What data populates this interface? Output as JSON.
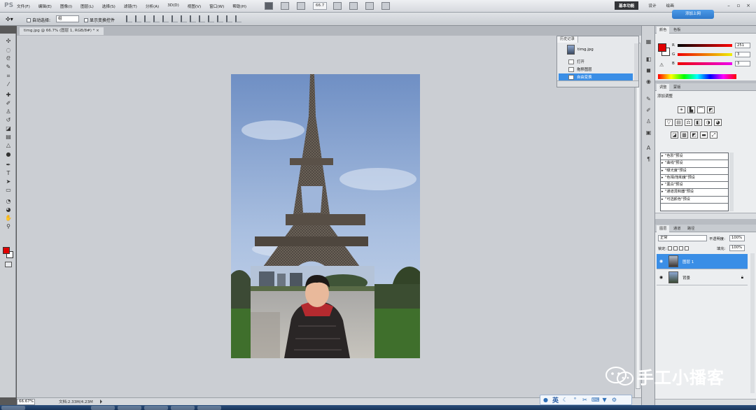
{
  "app": {
    "logo": "PS"
  },
  "menu": [
    "文件(F)",
    "编辑(E)",
    "图像(I)",
    "图层(L)",
    "选择(S)",
    "滤镜(T)",
    "分析(A)",
    "3D(D)",
    "视图(V)",
    "窗口(W)",
    "帮助(H)"
  ],
  "menubar": {
    "zoom": "66.7"
  },
  "workspace": {
    "active": "基本功能",
    "design": "设计",
    "painting": "绘画"
  },
  "cloud": {
    "label": "添加上网"
  },
  "options": {
    "auto_select_label": "自动选择:",
    "auto_select_value": "组",
    "show_transform_label": "显示变换控件"
  },
  "document": {
    "tab_title": "timg.jpg @ 66.7% (图层 1, RGB/8#) * ×",
    "zoom": "66.67%",
    "info": "文档:2.33M/4.23M"
  },
  "history": {
    "tabs": [
      "历史记录"
    ],
    "source": "timg.jpg",
    "steps": [
      {
        "label": "打开",
        "selected": false
      },
      {
        "label": "拖移图层",
        "selected": false
      },
      {
        "label": "自由变换",
        "selected": true
      }
    ]
  },
  "color": {
    "tabs": [
      "颜色",
      "色板"
    ],
    "channels": [
      {
        "label": "R",
        "value": "251"
      },
      {
        "label": "G",
        "value": "3"
      },
      {
        "label": "B",
        "value": "3"
      }
    ],
    "foreground": "#e00000",
    "background": "#ffffff"
  },
  "adjustments": {
    "tabs": [
      "调整",
      "蒙版"
    ],
    "title": "添加调整",
    "presets": [
      "\"色阶\"预设",
      "\"曲线\"预设",
      "\"曝光度\"预设",
      "\"色相/饱和度\"预设",
      "\"黑白\"预设",
      "\"通道混和器\"预设",
      "\"可选颜色\"预设"
    ]
  },
  "layers": {
    "tabs": [
      "图层",
      "通道",
      "路径"
    ],
    "blend_mode": "正常",
    "opacity_label": "不透明度:",
    "opacity": "100%",
    "lock_label": "锁定:",
    "fill_label": "填充:",
    "fill": "100%",
    "items": [
      {
        "name": "图层 1",
        "selected": true
      },
      {
        "name": "背景",
        "selected": false
      }
    ]
  },
  "ime": {
    "lang": "英"
  },
  "watermark": {
    "text": "手工小播客"
  }
}
